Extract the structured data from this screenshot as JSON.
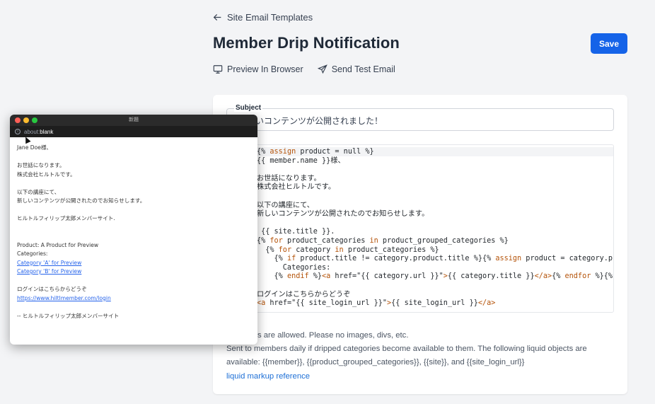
{
  "header": {
    "back_label": "Site Email Templates",
    "title": "Member Drip Notification",
    "save_label": "Save",
    "preview_label": "Preview In Browser",
    "test_label": "Send Test Email"
  },
  "form": {
    "subject_label": "Subject",
    "subject_value": "いコンテンツが公開されました！",
    "help_line1": "l <a> tags are allowed. Please no images, divs, etc.",
    "help_line2": "Sent to members daily if dripped categories become available to them. The following liquid objects are",
    "help_line3": "available: {{member}}, {{product_grouped_categories}}, {{site}}, and {{site_login_url}}",
    "help_link": "liquid markup reference"
  },
  "code_lines": [
    "{% assign product = null %}",
    "{{ member.name }}様、",
    "",
    "お世話になります。",
    "株式会社ヒルトルです。",
    "",
    "以下の講座にて、",
    "新しいコンテンツが公開されたのでお知らせします。",
    "",
    " {{ site.title }}.",
    "{% for product_categories in product_grouped_categories %}",
    "  {% for category in product_categories %}",
    "    {% if product.title != category.product.title %}{% assign product = category.product",
    "      Categories:",
    "    {% endif %}<a href=\"{{ category.url }}\">{{ category.title }}</a>{% endfor %}{% endfo",
    "",
    "ログインはこちらからどうぞ",
    "<a href=\"{{ site_login_url }}\">{{ site_login_url }}</a>"
  ],
  "popup": {
    "title": "新題",
    "url_prefix": "about:",
    "url_host": "blank",
    "lines": [
      "Jane Doe様、",
      "",
      "お世話になります。",
      "株式会社ヒルトルです。",
      "",
      "以下の講座にて、",
      "新しいコンテンツが公開されたのでお知らせします。",
      "",
      "ヒルトルフィリップ太郎メンバーサイト.",
      "",
      "",
      "Product: A Product for Preview",
      "Categories:"
    ],
    "link1": "Category 'A' for Preview",
    "link2": "Category 'B' for Preview",
    "login_text": "ログインはこちらからどうぞ",
    "login_link": "https://www.hiltlmember.com/login",
    "signoff": "-- ヒルトルフィリップ太郎メンバーサイト"
  },
  "colors": {
    "accent": "#1563e8",
    "link": "#1d6fd6",
    "liquid_keyword": "#b45309",
    "traffic_red": "#ff5f57",
    "traffic_yellow": "#febc2e",
    "traffic_green": "#28c840"
  }
}
